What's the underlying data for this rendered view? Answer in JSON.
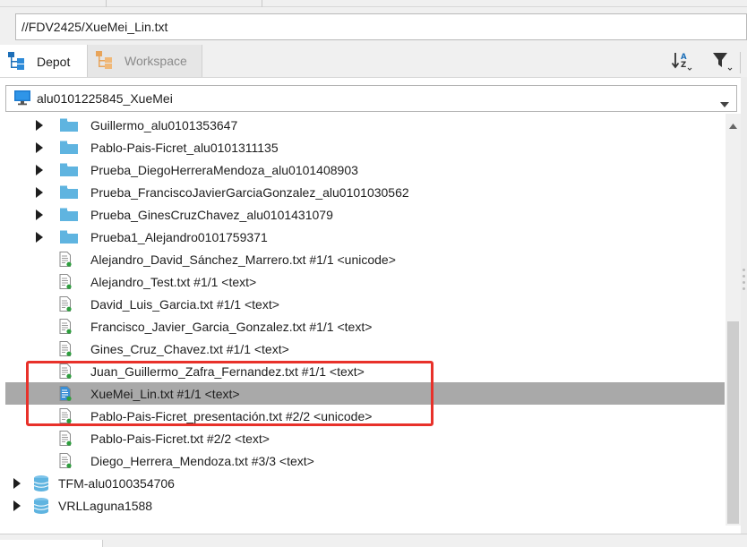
{
  "path_bar": {
    "value": "//FDV2425/XueMei_Lin.txt"
  },
  "tabs": [
    {
      "label": "Depot",
      "icon": "depot-tree-icon",
      "active": true
    },
    {
      "label": "Workspace",
      "icon": "workspace-tree-icon",
      "active": false
    }
  ],
  "toolbar": {
    "sort_icon": "sort-az-icon",
    "filter_icon": "filter-funnel-icon"
  },
  "workspace_selector": {
    "value": "alu0101225845_XueMei",
    "icon": "monitor-icon"
  },
  "tree": {
    "rows": [
      {
        "label": "Guillermo_alu0101353647",
        "kind": "folder",
        "expandable": true
      },
      {
        "label": "Pablo-Pais-Ficret_alu0101311135",
        "kind": "folder",
        "expandable": true
      },
      {
        "label": "Prueba_DiegoHerreraMendoza_alu0101408903",
        "kind": "folder",
        "expandable": true
      },
      {
        "label": "Prueba_FranciscoJavierGarciaGonzalez_alu0101030562",
        "kind": "folder",
        "expandable": true
      },
      {
        "label": "Prueba_GinesCruzChavez_alu0101431079",
        "kind": "folder",
        "expandable": true
      },
      {
        "label": "Prueba1_Alejandro0101759371",
        "kind": "folder",
        "expandable": true
      },
      {
        "label": "Alejandro_David_Sánchez_Marrero.txt #1/1 <unicode>",
        "kind": "file"
      },
      {
        "label": "Alejandro_Test.txt #1/1 <text>",
        "kind": "file"
      },
      {
        "label": "David_Luis_Garcia.txt #1/1 <text>",
        "kind": "file"
      },
      {
        "label": "Francisco_Javier_Garcia_Gonzalez.txt #1/1 <text>",
        "kind": "file"
      },
      {
        "label": "Gines_Cruz_Chavez.txt #1/1 <text>",
        "kind": "file"
      },
      {
        "label": "Juan_Guillermo_Zafra_Fernandez.txt #1/1 <text>",
        "kind": "file"
      },
      {
        "label": "XueMei_Lin.txt #1/1 <text>",
        "kind": "file",
        "selected": true
      },
      {
        "label": "Pablo-Pais-Ficret_presentación.txt #2/2 <unicode>",
        "kind": "file"
      },
      {
        "label": "Pablo-Pais-Ficret.txt #2/2 <text>",
        "kind": "file"
      },
      {
        "label": "Diego_Herrera_Mendoza.txt #3/3 <text>",
        "kind": "file"
      },
      {
        "label": "TFM-alu0100354706",
        "kind": "depot",
        "expandable": true
      },
      {
        "label": "VRLLaguna1588",
        "kind": "depot",
        "expandable": true
      }
    ]
  },
  "colors": {
    "folder": "#5fb4e0",
    "selection": "#a9a9a9",
    "highlight_box": "#e8312a",
    "file_badge": "#2e9e3e"
  }
}
